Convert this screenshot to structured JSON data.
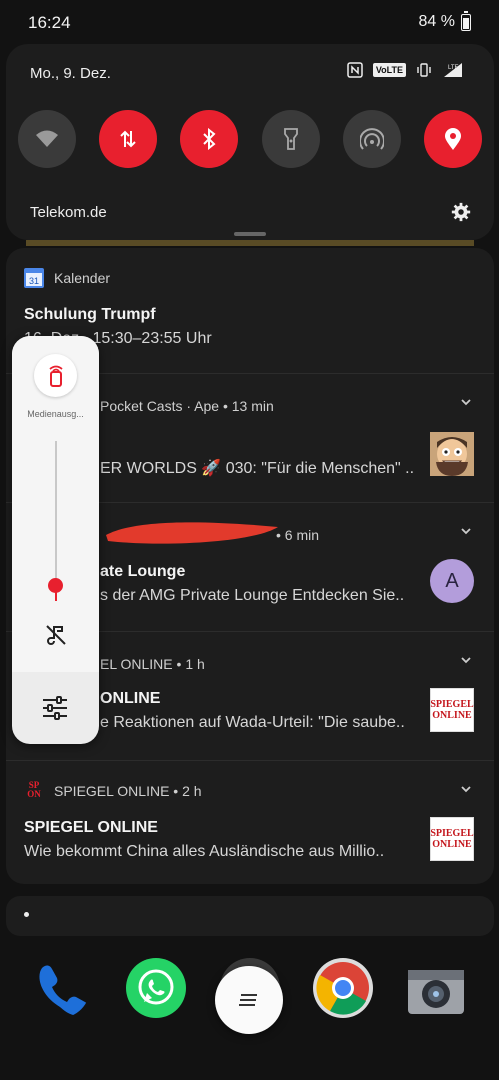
{
  "status_bar": {
    "time": "16:24",
    "battery": "84 %"
  },
  "quick_settings": {
    "date": "Mo., 9. Dez.",
    "volte": "VoLTE",
    "lte": "LTE",
    "carrier": "Telekom.de",
    "tiles": [
      {
        "icon": "wifi-icon",
        "active": false
      },
      {
        "icon": "mobile-data-icon",
        "active": true
      },
      {
        "icon": "bluetooth-icon",
        "active": true
      },
      {
        "icon": "flashlight-icon",
        "active": false
      },
      {
        "icon": "hotspot-icon",
        "active": false
      },
      {
        "icon": "location-icon",
        "active": true
      }
    ],
    "accent": "#e8202e"
  },
  "notifications": [
    {
      "app": "Kalender",
      "time": "",
      "title": "Schulung Trumpf",
      "body": "16. Dez., 15:30–23:55 Uhr"
    },
    {
      "app": "Pocket Casts · Ape",
      "time": "13 min",
      "title": "",
      "body": "ER WORLDS 🚀 030: \"Für die Menschen\" .."
    },
    {
      "app": "",
      "time": "6 min",
      "title": "ate Lounge",
      "body": "s der AMG Private Lounge Entdecken Sie..",
      "avatar": "A"
    },
    {
      "app": "EL ONLINE",
      "time": "1 h",
      "title": "ONLINE",
      "body": "e Reaktionen auf Wada-Urteil: \"Die saube.."
    },
    {
      "app": "SPIEGEL ONLINE",
      "time": "2 h",
      "title": "SPIEGEL ONLINE",
      "body": "Wie bekommt China alles Ausländische aus Millio.."
    }
  ],
  "spiegel_logo": {
    "line1": "SPIEGEL",
    "line2": "ONLINE",
    "small1": "SP",
    "small2": "ON"
  },
  "calendar_day": "31",
  "volume": {
    "label": "Medienausg...",
    "level": 0.1
  }
}
